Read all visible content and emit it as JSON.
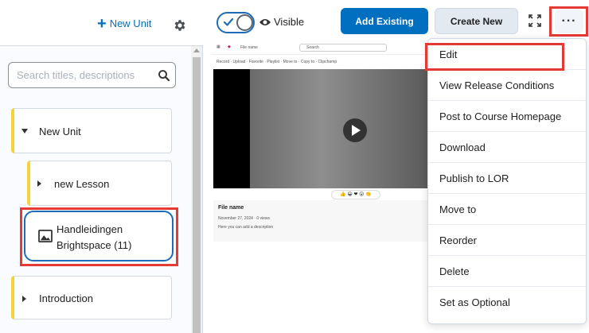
{
  "sidebar": {
    "new_unit_label": "New Unit",
    "search": {
      "placeholder": "Search titles, descriptions",
      "value": ""
    },
    "items": [
      {
        "label": "New Unit"
      },
      {
        "label": "new Lesson"
      },
      {
        "label_line1": "Handleidingen",
        "label_line2": "Brightspace (11)"
      },
      {
        "label": "Introduction"
      }
    ]
  },
  "toolbar": {
    "visible_label": "Visible",
    "add_existing_label": "Add Existing",
    "create_new_label": "Create New",
    "more_label": "···"
  },
  "preview": {
    "top_label": "File name",
    "search_label": "Search",
    "tool_labels": "Record · Upload · Favorite · Playlist · Move to · Copy to · Clipchamp",
    "title": "File name",
    "date": "November 27, 2024 · 0 views",
    "description": "Here you can add a description"
  },
  "menu": {
    "items": [
      "Edit",
      "View Release Conditions",
      "Post to Course Homepage",
      "Download",
      "Publish to LOR",
      "Move to",
      "Reorder",
      "Delete",
      "Set as Optional"
    ]
  },
  "colors": {
    "accent_blue": "#006fbf",
    "unit_accent_yellow": "#f4d43b",
    "highlight_red": "#e53935"
  }
}
